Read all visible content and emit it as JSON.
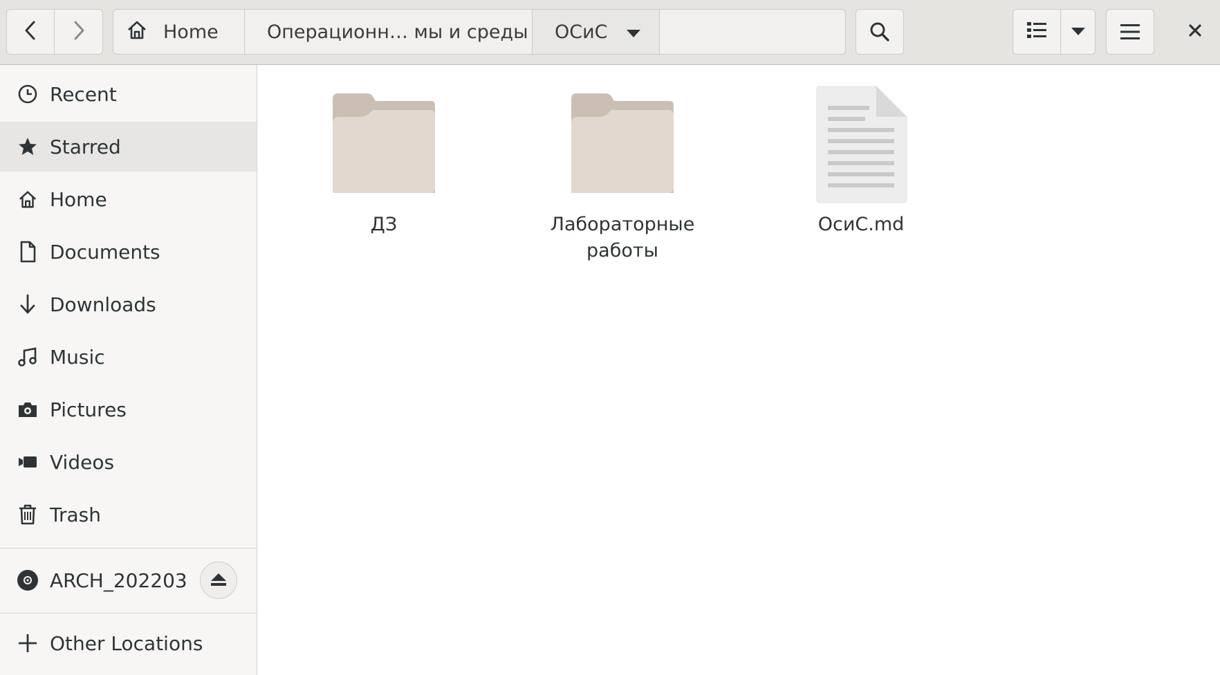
{
  "header": {
    "breadcrumbs": {
      "home": "Home",
      "middle": "Операционн… мы и среды",
      "current": "ОСиС"
    },
    "icons": {
      "back": "back-arrow-icon",
      "forward": "forward-arrow-icon",
      "home": "home-icon",
      "dropdown": "chevron-down-icon",
      "search": "search-icon",
      "view_list": "list-view-icon",
      "view_options": "chevron-down-icon",
      "menu": "hamburger-menu-icon",
      "close": "close-icon"
    }
  },
  "sidebar": {
    "items": [
      {
        "label": "Recent",
        "icon": "clock-icon"
      },
      {
        "label": "Starred",
        "icon": "star-icon"
      },
      {
        "label": "Home",
        "icon": "home-icon"
      },
      {
        "label": "Documents",
        "icon": "document-icon"
      },
      {
        "label": "Downloads",
        "icon": "download-icon"
      },
      {
        "label": "Music",
        "icon": "music-icon"
      },
      {
        "label": "Pictures",
        "icon": "camera-icon"
      },
      {
        "label": "Videos",
        "icon": "video-icon"
      },
      {
        "label": "Trash",
        "icon": "trash-icon"
      }
    ],
    "devices": [
      {
        "label": "ARCH_202203",
        "icon": "disc-icon",
        "action_icon": "eject-icon"
      }
    ],
    "other": {
      "label": "Other Locations",
      "icon": "plus-icon"
    }
  },
  "content": {
    "files": [
      {
        "name": "ДЗ",
        "type": "folder"
      },
      {
        "name": "Лабораторные работы",
        "type": "folder"
      },
      {
        "name": "ОсиС.md",
        "type": "text-file"
      }
    ]
  },
  "colors": {
    "folder_back": "#cbbfb4",
    "folder_front": "#e2d8cf",
    "header_bg": "#e6e4e1",
    "sidebar_bg": "#f7f6f5",
    "active_row": "#e8e6e4"
  }
}
